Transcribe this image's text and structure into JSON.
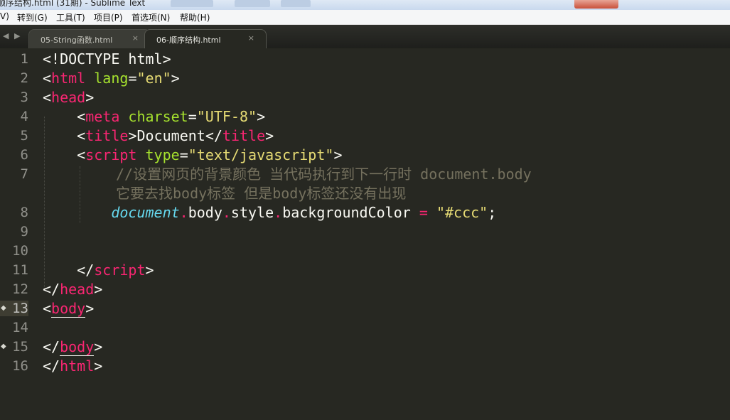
{
  "window": {
    "title": "顺序结构.html (31期) - Sublime Text"
  },
  "menu": [
    "V)",
    "转到(G)",
    "工具(T)",
    "项目(P)",
    "首选项(N)",
    "帮助(H)"
  ],
  "tabs": [
    {
      "label": "05-String函数.html",
      "close": "×",
      "active": false
    },
    {
      "label": "06-顺序结构.html",
      "close": "×",
      "active": true
    }
  ],
  "nav": {
    "back": "◀",
    "forward": "▶"
  },
  "gutter": [
    "1",
    "2",
    "3",
    "4",
    "5",
    "6",
    "7",
    "",
    "8",
    "9",
    "10",
    "11",
    "12",
    "13",
    "14",
    "15",
    "16"
  ],
  "current_line": "13",
  "bookmarked_lines": [
    "13",
    "15"
  ],
  "bookmark_icon": "tag-icon",
  "code": {
    "l1": {
      "a": "<!DOCTYPE html>"
    },
    "l2": {
      "lt": "<",
      "tag": "html",
      "attr": " lang",
      "eq": "=",
      "val": "\"en\"",
      "gt": ">"
    },
    "l3": {
      "lt": "<",
      "tag": "head",
      "gt": ">"
    },
    "l4": {
      "indent": "    ",
      "lt": "<",
      "tag": "meta",
      "attr": " charset",
      "eq": "=",
      "val": "\"UTF-8\"",
      "gt": ">"
    },
    "l5": {
      "indent": "    ",
      "lt": "<",
      "tag": "title",
      "gt": ">",
      "text": "Document",
      "lt2": "</",
      "tag2": "title",
      "gt2": ">"
    },
    "l6": {
      "indent": "    ",
      "lt": "<",
      "tag": "script",
      "attr": " type",
      "eq": "=",
      "val": "\"text/javascript\"",
      "gt": ">"
    },
    "l7a": "//设置网页的背景颜色 当代码执行到下一行时 document.body",
    "l7b": "它要去找body标签 但是body标签还没有出现",
    "l8": {
      "indent": "        ",
      "obj": "document",
      "dot1": ".",
      "p1": "body",
      "dot2": ".",
      "p2": "style",
      "dot3": ".",
      "p3": "backgroundColor",
      "sp": " ",
      "op": "=",
      "sp2": " ",
      "str": "\"#ccc\"",
      "semi": ";"
    },
    "l11": {
      "indent": "    ",
      "lt": "</",
      "tag": "script",
      "gt": ">"
    },
    "l12": {
      "lt": "</",
      "tag": "head",
      "gt": ">"
    },
    "l13": {
      "lt": "<",
      "tag": "body",
      "gt": ">"
    },
    "l15": {
      "lt": "</",
      "tag": "body",
      "gt": ">"
    },
    "l16": {
      "lt": "</",
      "tag": "html",
      "gt": ">"
    }
  },
  "colors": {
    "background": "#272822",
    "tag": "#f92672",
    "attribute": "#a6e22e",
    "string": "#e6db74",
    "comment": "#75715e",
    "builtin": "#66d9ef",
    "text": "#f8f8f2"
  }
}
